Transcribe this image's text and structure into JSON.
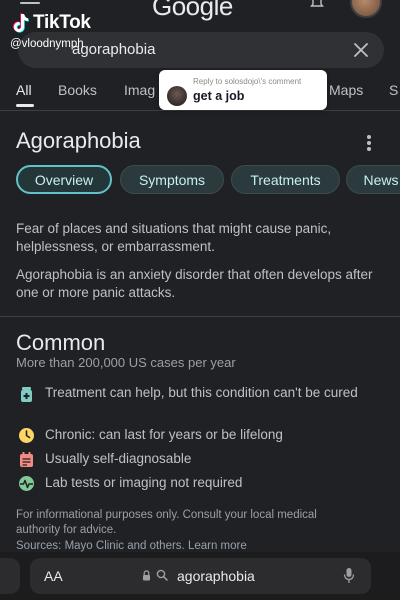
{
  "overlay": {
    "tiktok_label": "TikTok",
    "username": "@vloodnymph",
    "reply_header": "Reply to solosdojo\\'s comment",
    "reply_text": "get a job"
  },
  "header": {
    "logo": "Google"
  },
  "search": {
    "query": "agoraphobia"
  },
  "tabs": [
    {
      "label": "All",
      "active": true
    },
    {
      "label": "Books",
      "active": false
    },
    {
      "label": "Imag",
      "active": false
    },
    {
      "label": "Maps",
      "active": false
    },
    {
      "label": "S",
      "active": false
    }
  ],
  "knowledge_panel": {
    "title": "Agoraphobia",
    "chips": [
      {
        "label": "Overview",
        "active": true
      },
      {
        "label": "Symptoms",
        "active": false
      },
      {
        "label": "Treatments",
        "active": false
      },
      {
        "label": "News",
        "active": false
      }
    ],
    "description_1": "Fear of places and situations that might cause panic, helplessness, or embarrassment.",
    "description_2": "Agoraphobia is an anxiety disorder that often develops after one or more panic attacks.",
    "common_title": "Common",
    "common_sub": "More than 200,000 US cases per year",
    "facts": [
      {
        "icon": "medicine-bottle-icon",
        "text": "Treatment can help, but this condition can't be cured"
      },
      {
        "icon": "clock-icon",
        "text": "Chronic: can last for years or be lifelong"
      },
      {
        "icon": "calendar-icon",
        "text": "Usually self-diagnosable"
      },
      {
        "icon": "pulse-icon",
        "text": "Lab tests or imaging not required"
      }
    ],
    "footnote": "For informational purposes only. Consult your local medical authority for advice.",
    "sources": "Sources: Mayo Clinic and others. Learn more"
  },
  "browser": {
    "text_size_label": "AA",
    "url": "agoraphobia"
  },
  "colors": {
    "background": "#202124",
    "chip_accent": "#5fc3c9",
    "popup_bg": "#ffffff"
  }
}
